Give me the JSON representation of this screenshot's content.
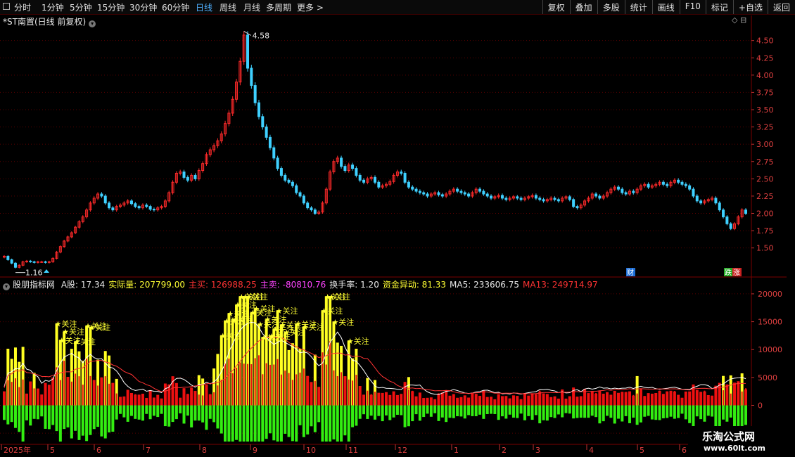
{
  "toolbar": {
    "timeframes": [
      "分时",
      "1分钟",
      "5分钟",
      "15分钟",
      "30分钟",
      "60分钟",
      "日线",
      "周线",
      "月线",
      "多周期",
      "更多 >"
    ],
    "active": "日线",
    "right_buttons": [
      "复权",
      "叠加",
      "多股",
      "统计",
      "画线",
      "F10",
      "标记",
      "+自选",
      "返回"
    ]
  },
  "stock_title": "*ST南置(日线 前复权)",
  "top_icons": "◇ ⊟",
  "price_chart": {
    "ylim": [
      1.1,
      4.7
    ],
    "ticks": [
      "4.50",
      "4.25",
      "4.00",
      "3.75",
      "3.50",
      "3.25",
      "3.00",
      "2.75",
      "2.50",
      "2.25",
      "2.00",
      "1.75",
      "1.50"
    ],
    "tick_values": [
      4.5,
      4.25,
      4.0,
      3.75,
      3.5,
      3.25,
      3.0,
      2.75,
      2.5,
      2.25,
      2.0,
      1.75,
      1.5
    ],
    "high_label": "4.58",
    "low_label": "1.16",
    "closes": [
      1.38,
      1.33,
      1.28,
      1.22,
      1.25,
      1.3,
      1.31,
      1.3,
      1.29,
      1.3,
      1.3,
      1.29,
      1.3,
      1.35,
      1.44,
      1.52,
      1.6,
      1.66,
      1.72,
      1.8,
      1.88,
      1.95,
      2.05,
      2.15,
      2.22,
      2.28,
      2.25,
      2.15,
      2.08,
      2.05,
      2.1,
      2.12,
      2.15,
      2.18,
      2.14,
      2.1,
      2.08,
      2.12,
      2.1,
      2.06,
      2.05,
      2.08,
      2.1,
      2.18,
      2.3,
      2.45,
      2.58,
      2.6,
      2.52,
      2.48,
      2.55,
      2.5,
      2.62,
      2.72,
      2.85,
      2.92,
      2.98,
      3.05,
      3.15,
      3.3,
      3.45,
      3.65,
      3.9,
      4.2,
      4.58,
      4.1,
      3.85,
      3.6,
      3.4,
      3.25,
      3.1,
      2.95,
      2.8,
      2.65,
      2.55,
      2.48,
      2.45,
      2.4,
      2.3,
      2.25,
      2.15,
      2.08,
      2.05,
      2.0,
      2.02,
      2.15,
      2.35,
      2.6,
      2.75,
      2.8,
      2.68,
      2.62,
      2.7,
      2.65,
      2.55,
      2.48,
      2.45,
      2.5,
      2.52,
      2.45,
      2.38,
      2.4,
      2.42,
      2.46,
      2.55,
      2.6,
      2.58,
      2.45,
      2.38,
      2.35,
      2.32,
      2.3,
      2.28,
      2.25,
      2.28,
      2.3,
      2.27,
      2.25,
      2.28,
      2.32,
      2.35,
      2.32,
      2.3,
      2.28,
      2.25,
      2.3,
      2.35,
      2.32,
      2.28,
      2.25,
      2.22,
      2.24,
      2.26,
      2.22,
      2.2,
      2.22,
      2.24,
      2.22,
      2.2,
      2.22,
      2.24,
      2.26,
      2.22,
      2.2,
      2.18,
      2.2,
      2.22,
      2.2,
      2.18,
      2.22,
      2.24,
      2.2,
      2.1,
      2.08,
      2.12,
      2.18,
      2.22,
      2.28,
      2.25,
      2.22,
      2.25,
      2.3,
      2.35,
      2.38,
      2.35,
      2.3,
      2.28,
      2.32,
      2.3,
      2.35,
      2.4,
      2.42,
      2.38,
      2.4,
      2.42,
      2.45,
      2.42,
      2.4,
      2.45,
      2.48,
      2.45,
      2.42,
      2.4,
      2.35,
      2.25,
      2.18,
      2.15,
      2.18,
      2.2,
      2.22,
      2.15,
      2.05,
      1.95,
      1.85,
      1.78,
      1.85,
      1.95,
      2.05,
      2.0
    ],
    "badges": [
      {
        "text": "财",
        "color": "#1e6fd8"
      },
      {
        "text": "跌",
        "color": "#22aa22"
      },
      {
        "text": "涨",
        "color": "#cc2222"
      }
    ]
  },
  "indicator": {
    "name": "股朋指标网",
    "readings": [
      {
        "label": "A股: ",
        "value": "17.34",
        "color": "#e8e8e8"
      },
      {
        "label": "实际量: ",
        "value": "207799.00",
        "color": "#ffff33"
      },
      {
        "label": "主买: ",
        "value": "126988.25",
        "color": "#ff3333"
      },
      {
        "label": "主卖: ",
        "value": "-80810.76",
        "color": "#ff44ff"
      },
      {
        "label": "换手率: ",
        "value": "1.20",
        "color": "#e8e8e8"
      },
      {
        "label": "资金异动: ",
        "value": "81.33",
        "color": "#ffff33"
      },
      {
        "label": "MA5: ",
        "value": "233606.75",
        "color": "#e8e8e8"
      },
      {
        "label": "MA13: ",
        "value": "249714.97",
        "color": "#ff3333"
      }
    ],
    "ylim": [
      -7000,
      21000
    ],
    "ticks": [
      "20000",
      "15000",
      "10000",
      "5000",
      "0",
      "-5000"
    ],
    "tick_values": [
      20000,
      15000,
      10000,
      5000,
      0,
      -5000
    ],
    "attention_label": "★关注",
    "attention_count": 31
  },
  "x_axis": [
    "2025年",
    "5",
    "6",
    "7",
    "8",
    "9",
    "10",
    "11",
    "12",
    "1",
    "2",
    "3",
    "4",
    "5",
    "6"
  ],
  "colors": {
    "up": "#ff2a2a",
    "down": "#3fd0ff",
    "yellow": "#ffff22",
    "red": "#ee1111",
    "green": "#33ee11",
    "grid": "#5a0000"
  },
  "watermark": {
    "line1": "乐淘公式网",
    "line2": "www.60lt.com"
  }
}
